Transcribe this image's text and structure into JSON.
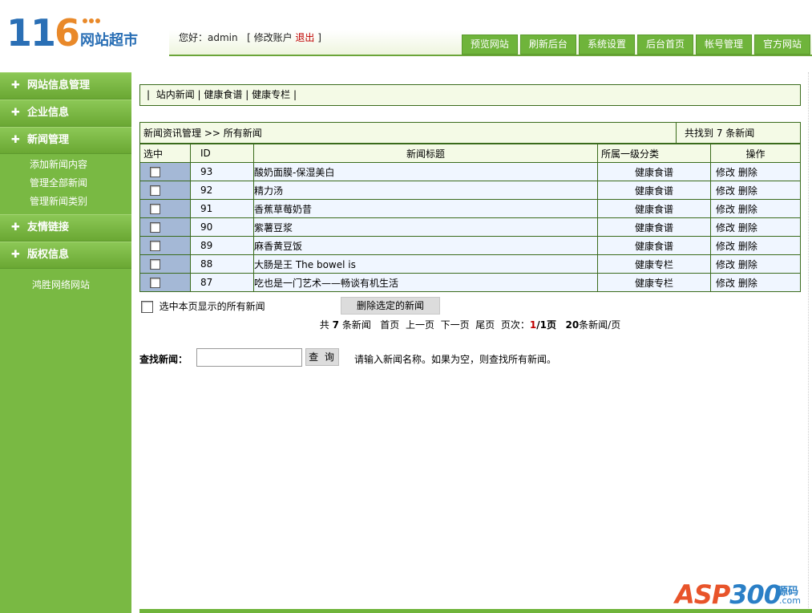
{
  "logo": {
    "num_a": "11",
    "num_b": "6",
    "cn": "网站超市"
  },
  "greeting": {
    "hello": "您好：admin",
    "bracket_open": "[",
    "edit_account": "修改账户",
    "logout": "退出",
    "bracket_close": "]"
  },
  "topnav": [
    "预览网站",
    "刷新后台",
    "系统设置",
    "后台首页",
    "帐号管理",
    "官方网站"
  ],
  "sidebar": {
    "items": [
      {
        "label": "网站信息管理"
      },
      {
        "label": "企业信息"
      },
      {
        "label": "新闻管理",
        "sub": [
          "添加新闻内容",
          "管理全部新闻",
          "管理新闻类别"
        ]
      },
      {
        "label": "友情链接"
      },
      {
        "label": "版权信息",
        "sub": [
          "鸿胜网络网站"
        ]
      }
    ]
  },
  "category_tabs": {
    "sep": "|",
    "tabs": [
      "站内新闻",
      "健康食谱",
      "健康专栏"
    ]
  },
  "list": {
    "breadcrumb": "新闻资讯管理 >> 所有新闻",
    "found": "共找到 7 条新闻",
    "headers": [
      "选中",
      "ID",
      "新闻标题",
      "所属一级分类",
      "操作"
    ],
    "rows": [
      {
        "id": "93",
        "title": "酸奶面膜-保湿美白",
        "category": "健康食谱",
        "edit": "修改",
        "del": "删除"
      },
      {
        "id": "92",
        "title": "精力汤",
        "category": "健康食谱",
        "edit": "修改",
        "del": "删除"
      },
      {
        "id": "91",
        "title": "香蕉草莓奶昔",
        "category": "健康食谱",
        "edit": "修改",
        "del": "删除"
      },
      {
        "id": "90",
        "title": "紫薯豆浆",
        "category": "健康食谱",
        "edit": "修改",
        "del": "删除"
      },
      {
        "id": "89",
        "title": "麻香黄豆饭",
        "category": "健康食谱",
        "edit": "修改",
        "del": "删除"
      },
      {
        "id": "88",
        "title": "大肠是王 The bowel is",
        "category": "健康专栏",
        "edit": "修改",
        "del": "删除"
      },
      {
        "id": "87",
        "title": "吃也是一门艺术——畅谈有机生活",
        "category": "健康专栏",
        "edit": "修改",
        "del": "删除"
      }
    ]
  },
  "bulk": {
    "select_all": "选中本页显示的所有新闻",
    "delete_selected": "删除选定的新闻"
  },
  "pager": {
    "total_pre": "共",
    "total_num": "7",
    "total_post": "条新闻",
    "first": "首页",
    "prev": "上一页",
    "next": "下一页",
    "last": "尾页",
    "page_label": "页次：",
    "page_cur": "1",
    "page_total": "/1页",
    "per_page_num": "20",
    "per_page_post": "条新闻/页"
  },
  "search": {
    "label": "查找新闻：",
    "value": "",
    "button": "查 询",
    "hint": "请输入新闻名称。如果为空，则查找所有新闻。"
  },
  "watermark": {
    "asp": "ASP",
    "num": "300",
    "ym": "源码",
    "com": ".com"
  },
  "colors": {
    "green": "#79b943",
    "border": "#3a6b1c",
    "row_bg": "#f0f6ff",
    "check_col": "#a4b8d6",
    "red": "#c00000"
  }
}
